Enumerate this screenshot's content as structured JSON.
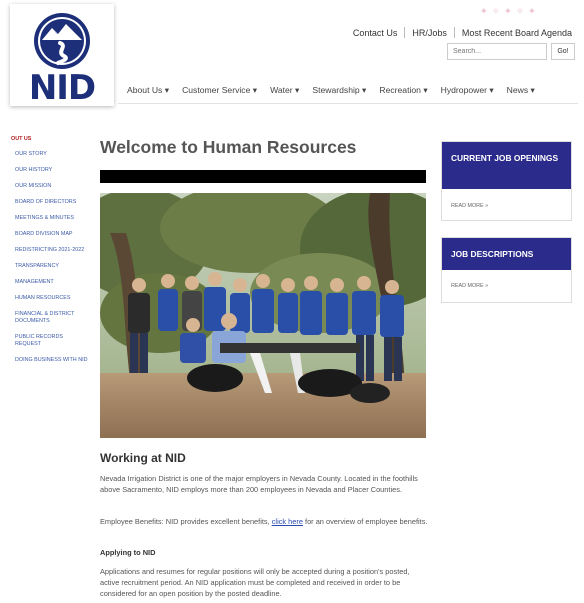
{
  "brand": {
    "logo_text": "NID",
    "top_right_blur": "✦ ✧ ✦ ✧ ✦"
  },
  "header": {
    "util_links": [
      "Contact Us",
      "HR/Jobs",
      "Most Recent Board Agenda"
    ],
    "search": {
      "placeholder": "Search...",
      "go_label": "Go!"
    }
  },
  "nav": [
    "About Us ▾",
    "Customer Service ▾",
    "Water ▾",
    "Stewardship ▾",
    "Recreation ▾",
    "Hydropower ▾",
    "News ▾"
  ],
  "sidebar": {
    "title": "OUT US",
    "items": [
      "OUR STORY",
      "OUR HISTORY",
      "OUR MISSION",
      "BOARD OF DIRECTORS",
      "MEETINGS & MINUTES",
      "BOARD DIVISION MAP",
      "REDISTRICTING 2021-2022",
      "TRANSPARENCY",
      "MANAGEMENT",
      "HUMAN RESOURCES",
      "FINANCIAL & DISTRICT DOCUMENTS",
      "PUBLIC RECORDS REQUEST",
      "DOING BUSINESS WITH NID"
    ]
  },
  "main": {
    "title": "Welcome to Human Resources",
    "section_title": "Working at NID",
    "p1": "Nevada Irrigation District is one of the major employers in Nevada County. Located in the foothills above Sacramento, NID employs more than 200 employees in Nevada and Placer Counties.",
    "p2_before": "Employee Benefits: NID provides excellent benefits,",
    "p2_link": "click here",
    "p2_after": "for an overview of employee benefits.",
    "applying_title": "Applying to NID",
    "p3": "Applications and resumes for regular positions will only be accepted during a position's posted, active recruitment period. An NID application must be completed and received in order to be considered for an open position by the posted deadline."
  },
  "cards": [
    {
      "title": "CURRENT JOB OPENINGS",
      "more": "READ MORE »"
    },
    {
      "title": "JOB DESCRIPTIONS",
      "more": "READ MORE »"
    }
  ],
  "colors": {
    "brand_navy": "#1e2f7a",
    "card_header": "#2b2b8c",
    "sidebar_link": "#3a5aa8",
    "sidebar_title": "#b02020"
  }
}
